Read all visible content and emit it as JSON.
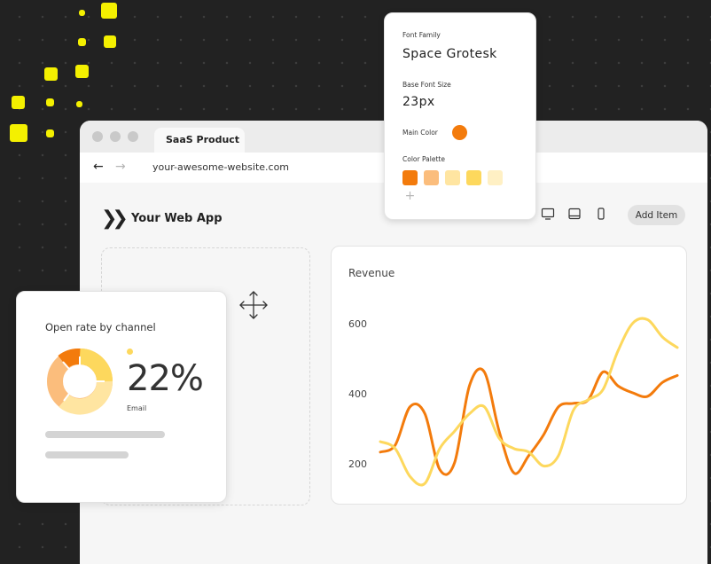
{
  "colors": {
    "accent_yellow": "#f4f000",
    "orange": "#f37b0c",
    "light_orange": "#fbbd7c",
    "pale_yellow": "#ffe5a1",
    "yellow": "#fdd85d",
    "cream": "#fff0c4"
  },
  "browser": {
    "tab_label": "SaaS Product",
    "url": "your-awesome-website.com",
    "back_icon": "arrow-left-icon",
    "forward_icon": "arrow-right-icon"
  },
  "app": {
    "logo_icon": "double-chevron-icon",
    "title": "Your Web App",
    "device_icons": [
      "desktop-icon",
      "laptop-icon",
      "mobile-icon"
    ],
    "add_item_label": "Add Item"
  },
  "font_panel": {
    "font_family_label": "Font Family",
    "font_family_value": "Space Grotesk",
    "base_size_label": "Base Font Size",
    "base_size_value": "23px",
    "main_color_label": "Main Color",
    "main_color": "#f37b0c",
    "palette_label": "Color Palette",
    "palette": [
      "#f37b0c",
      "#fbbd7c",
      "#ffe5a1",
      "#fdd85d",
      "#fff0c4"
    ],
    "add_icon": "plus-icon"
  },
  "open_rate": {
    "title": "Open rate by channel",
    "percent": "22%",
    "channel": "Email"
  },
  "chart_data": {
    "type": "line",
    "title": "Revenue",
    "y_ticks": [
      "600",
      "400",
      "200"
    ],
    "ylim": [
      160,
      720
    ],
    "x": [
      0,
      1,
      2,
      3,
      4,
      5,
      6,
      7,
      8,
      9,
      10,
      11,
      12,
      13,
      14,
      15,
      16,
      17,
      18,
      19,
      20
    ],
    "series": [
      {
        "color": "#f37b0c",
        "values": [
          270,
          290,
          400,
          380,
          220,
          240,
          460,
          500,
          330,
          210,
          260,
          320,
          400,
          410,
          420,
          500,
          460,
          440,
          430,
          470,
          490
        ]
      },
      {
        "color": "#fdd85d",
        "values": [
          300,
          280,
          200,
          180,
          280,
          330,
          380,
          400,
          310,
          280,
          270,
          230,
          260,
          390,
          420,
          450,
          560,
          640,
          650,
          600,
          570
        ]
      }
    ]
  }
}
